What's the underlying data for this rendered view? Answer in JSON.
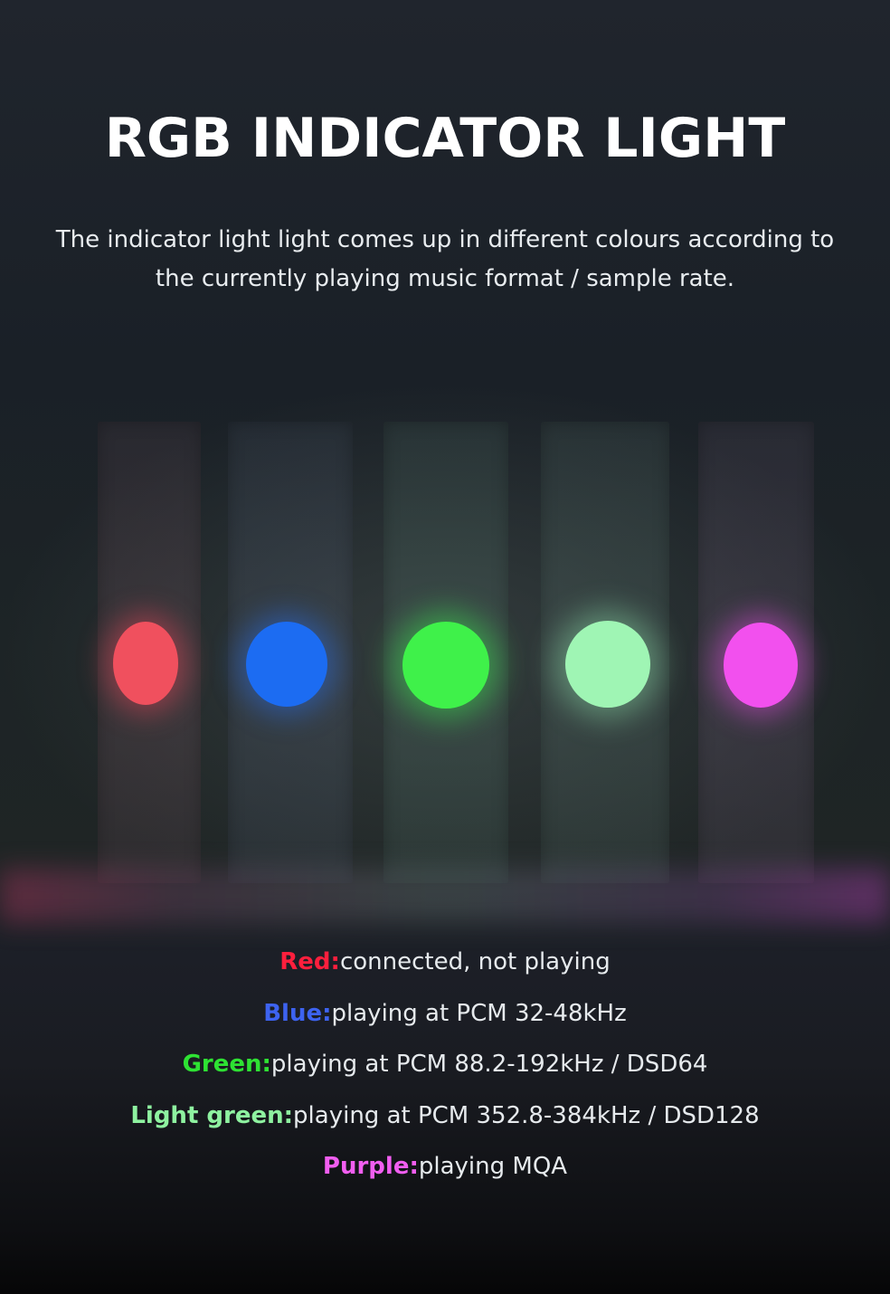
{
  "header": {
    "title": "RGB INDICATOR LIGHT",
    "description": "The indicator light light comes up in different colours according to the currently playing music format / sample rate."
  },
  "indicators": [
    {
      "color_name": "Red:",
      "color": "#ff1f3d",
      "description": "connected, not playing"
    },
    {
      "color_name": "Blue:",
      "color": "#3d63f0",
      "description": "playing at PCM 32-48kHz"
    },
    {
      "color_name": "Green:",
      "color": "#2ee233",
      "description": "playing at PCM 88.2-192kHz / DSD64"
    },
    {
      "color_name": "Light green:",
      "color": "#8ef2a0",
      "description": "playing at PCM 352.8-384kHz / DSD128"
    },
    {
      "color_name": "Purple:",
      "color": "#f15ef0",
      "description": "playing MQA"
    }
  ]
}
